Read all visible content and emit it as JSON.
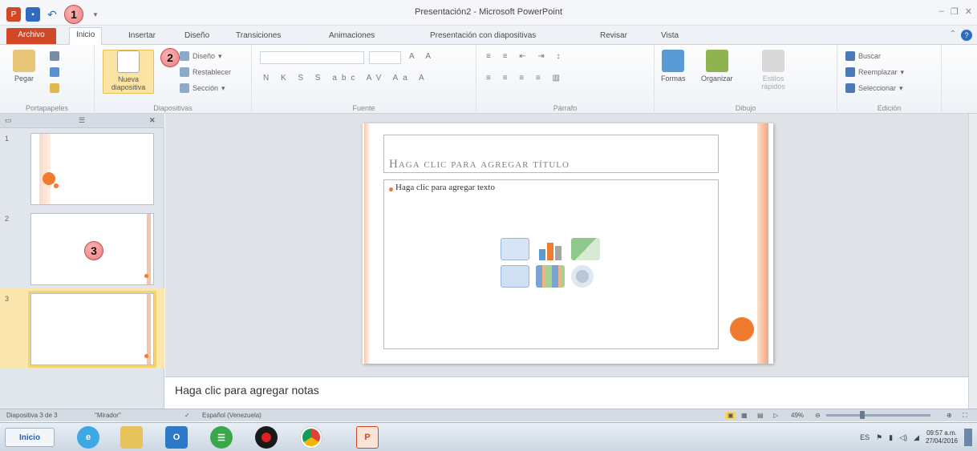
{
  "window": {
    "title": "Presentación2 - Microsoft PowerPoint"
  },
  "callouts": {
    "c1": "1",
    "c2": "2",
    "c3": "3"
  },
  "tabs": [
    {
      "label": "Archivo"
    },
    {
      "label": "Inicio"
    },
    {
      "label": "Insertar"
    },
    {
      "label": "Diseño"
    },
    {
      "label": "Transiciones"
    },
    {
      "label": "Animaciones"
    },
    {
      "label": "Presentación con diapositivas"
    },
    {
      "label": "Revisar"
    },
    {
      "label": "Vista"
    }
  ],
  "ribbon": {
    "portapapeles": {
      "pegar": "Pegar",
      "label": "Portapapeles"
    },
    "diapositivas": {
      "nueva": "Nueva diapositiva",
      "diseno": "Diseño",
      "restablecer": "Restablecer",
      "seccion": "Sección",
      "label": "Diapositivas"
    },
    "fuente": {
      "label": "Fuente"
    },
    "parrafo": {
      "label": "Párrafo"
    },
    "dibujo": {
      "formas": "Formas",
      "organizar": "Organizar",
      "estilos": "Estilos rápidos",
      "label": "Dibujo"
    },
    "edicion": {
      "buscar": "Buscar",
      "reemplazar": "Reemplazar",
      "seleccionar": "Seleccionar",
      "label": "Edición"
    }
  },
  "slides_panel": {
    "thumbnails": [
      {
        "number": "1"
      },
      {
        "number": "2"
      },
      {
        "number": "3"
      }
    ]
  },
  "slide": {
    "title_placeholder": "Haga clic para agregar título",
    "body_placeholder": "Haga clic para agregar texto"
  },
  "notes": {
    "placeholder": "Haga clic para agregar notas"
  },
  "statusbar": {
    "slide_count": "Diapositiva 3 de 3",
    "theme": "\"Mirador\"",
    "language": "Español (Venezuela)",
    "zoom": "49%"
  },
  "taskbar": {
    "start": "Inicio",
    "lang": "ES",
    "time": "09:57 a.m.",
    "date": "27/04/2016"
  },
  "colors": {
    "accent_orange": "#f07b2f",
    "file_tab": "#d24726",
    "selection": "#f6d36b"
  }
}
